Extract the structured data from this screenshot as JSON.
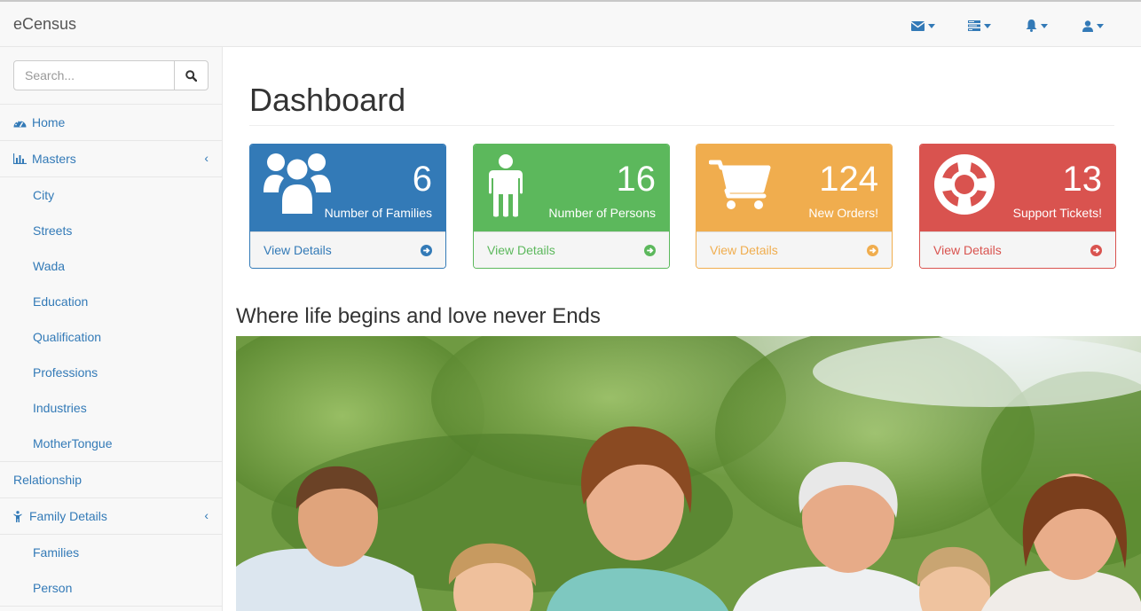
{
  "app": {
    "brand": "eCensus"
  },
  "topnav": {
    "items": [
      {
        "icon": "envelope-icon"
      },
      {
        "icon": "tasks-icon"
      },
      {
        "icon": "bell-icon"
      },
      {
        "icon": "user-icon"
      }
    ]
  },
  "sidebar": {
    "search": {
      "placeholder": "Search..."
    },
    "home": "Home",
    "masters": {
      "label": "Masters",
      "items": [
        "City",
        "Streets",
        "Wada",
        "Education",
        "Qualification",
        "Professions",
        "Industries",
        "MotherTongue"
      ]
    },
    "relationship": "Relationship",
    "family_details": {
      "label": "Family Details",
      "items": [
        "Families",
        "Person"
      ]
    }
  },
  "main": {
    "title": "Dashboard",
    "panels": [
      {
        "value": "6",
        "label": "Number of Families",
        "footer": "View Details",
        "color": "#337ab7",
        "icon": "users-icon"
      },
      {
        "value": "16",
        "label": "Number of Persons",
        "footer": "View Details",
        "color": "#5cb85c",
        "icon": "person-icon"
      },
      {
        "value": "124",
        "label": "New Orders!",
        "footer": "View Details",
        "color": "#f0ad4e",
        "icon": "shopping-cart-icon"
      },
      {
        "value": "13",
        "label": "Support Tickets!",
        "footer": "View Details",
        "color": "#d9534f",
        "icon": "life-ring-icon"
      }
    ],
    "tagline": "Where life begins and love never Ends"
  }
}
